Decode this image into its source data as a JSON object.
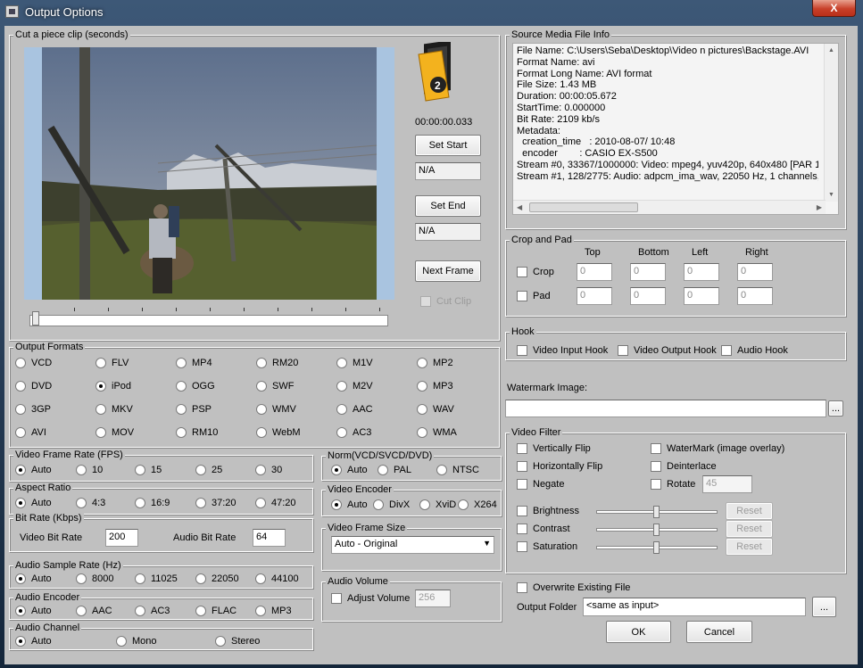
{
  "window": {
    "title": "Output Options",
    "close_label": "X"
  },
  "clip": {
    "legend": "Cut a piece clip (seconds)",
    "timecode": "00:00:00.033",
    "set_start_label": "Set Start",
    "start_value": "N/A",
    "set_end_label": "Set End",
    "end_value": "N/A",
    "next_frame_label": "Next Frame",
    "cut_clip_label": "Cut Clip"
  },
  "source_info": {
    "legend": "Source Media File Info",
    "lines": [
      "File Name: C:\\Users\\Seba\\Desktop\\Video n pictures\\Backstage.AVI",
      "Format Name: avi",
      "Format Long Name: AVI format",
      "File Size: 1.43 MB",
      "Duration: 00:00:05.672",
      "StartTime: 0.000000",
      "Bit Rate: 2109 kb/s",
      "Metadata:",
      "  creation_time   : 2010-08-07/ 10:48",
      "  encoder        : CASIO EX-S500",
      "Stream #0, 33367/1000000: Video: mpeg4, yuv420p, 640x480 [PAR 1",
      "Stream #1, 128/2775: Audio: adpcm_ima_wav, 22050 Hz, 1 channels,"
    ]
  },
  "output_formats": {
    "legend": "Output Formats",
    "selected": "iPod",
    "items": [
      "VCD",
      "FLV",
      "MP4",
      "RM20",
      "M1V",
      "MP2",
      "DVD",
      "iPod",
      "OGG",
      "SWF",
      "M2V",
      "MP3",
      "3GP",
      "MKV",
      "PSP",
      "WMV",
      "AAC",
      "WAV",
      "AVI",
      "MOV",
      "RM10",
      "WebM",
      "AC3",
      "WMA"
    ]
  },
  "frame_rate": {
    "legend": "Video Frame Rate (FPS)",
    "options": [
      "Auto",
      "10",
      "15",
      "25",
      "30"
    ],
    "selected": "Auto"
  },
  "aspect_ratio": {
    "legend": "Aspect Ratio",
    "options": [
      "Auto",
      "4:3",
      "16:9",
      "37:20",
      "47:20"
    ],
    "selected": "Auto"
  },
  "bit_rate": {
    "legend": "Bit Rate (Kbps)",
    "video_label": "Video Bit Rate",
    "video_value": "200",
    "audio_label": "Audio Bit Rate",
    "audio_value": "64"
  },
  "sample_rate": {
    "legend": "Audio Sample Rate (Hz)",
    "options": [
      "Auto",
      "8000",
      "11025",
      "22050",
      "44100"
    ],
    "selected": "Auto"
  },
  "audio_encoder": {
    "legend": "Audio Encoder",
    "options": [
      "Auto",
      "AAC",
      "AC3",
      "FLAC",
      "MP3"
    ],
    "selected": "Auto"
  },
  "audio_channel": {
    "legend": "Audio Channel",
    "options": [
      "Auto",
      "Mono",
      "Stereo"
    ],
    "selected": "Auto"
  },
  "norm": {
    "legend": "Norm(VCD/SVCD/DVD)",
    "options": [
      "Auto",
      "PAL",
      "NTSC"
    ],
    "selected": "Auto"
  },
  "video_encoder": {
    "legend": "Video Encoder",
    "options": [
      "Auto",
      "DivX",
      "XviD",
      "X264"
    ],
    "selected": "Auto"
  },
  "frame_size": {
    "legend": "Video Frame Size",
    "value": "Auto - Original"
  },
  "audio_volume": {
    "legend": "Audio Volume",
    "adjust_label": "Adjust Volume",
    "value": "256"
  },
  "crop_pad": {
    "legend": "Crop and Pad",
    "headers": [
      "Top",
      "Bottom",
      "Left",
      "Right"
    ],
    "crop_label": "Crop",
    "pad_label": "Pad",
    "crop_values": [
      "0",
      "0",
      "0",
      "0"
    ],
    "pad_values": [
      "0",
      "0",
      "0",
      "0"
    ]
  },
  "hook": {
    "legend": "Hook",
    "items": [
      "Video Input Hook",
      "Video Output Hook",
      "Audio Hook"
    ]
  },
  "watermark": {
    "label": "Watermark Image:",
    "value": "",
    "browse_label": "..."
  },
  "video_filter": {
    "legend": "Video Filter",
    "left": [
      "Vertically Flip",
      "Horizontally Flip",
      "Negate"
    ],
    "right": [
      "WaterMark (image overlay)",
      "Deinterlace",
      "Rotate"
    ],
    "rotate_value": "45",
    "sliders": [
      {
        "label": "Brightness",
        "reset": "Reset",
        "level": 0.5
      },
      {
        "label": "Contrast",
        "reset": "Reset",
        "level": 0.5
      },
      {
        "label": "Saturation",
        "reset": "Reset",
        "level": 0.5
      }
    ]
  },
  "overwrite_label": "Overwrite Existing File",
  "output_folder": {
    "label": "Output Folder",
    "value": "<same as input>",
    "browse_label": "..."
  },
  "ok_label": "OK",
  "cancel_label": "Cancel"
}
